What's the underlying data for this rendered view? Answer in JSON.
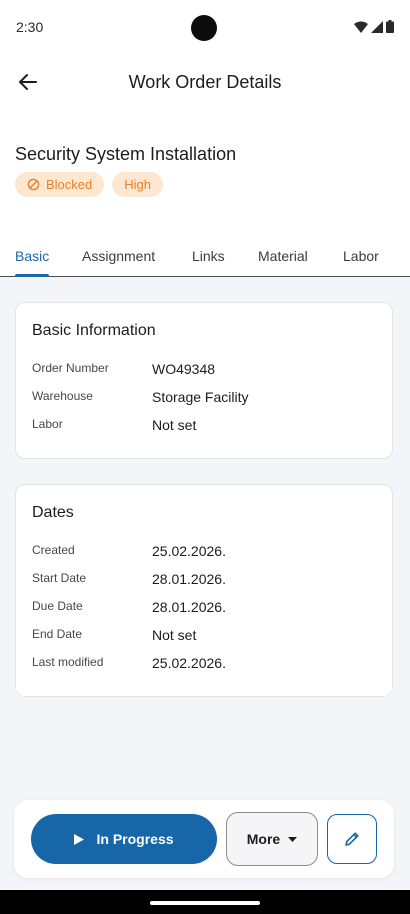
{
  "status_bar": {
    "time": "2:30"
  },
  "app_bar": {
    "title": "Work Order Details",
    "back_icon": "arrow-left-icon"
  },
  "work_order": {
    "title": "Security System Installation",
    "badges": [
      {
        "label": "Blocked",
        "icon": "blocked-icon",
        "color": "#e3832b",
        "bg": "#fde7d1"
      },
      {
        "label": "High",
        "color": "#e3832b",
        "bg": "#fde7d1"
      }
    ]
  },
  "tabs": [
    {
      "label": "Basic",
      "active": true
    },
    {
      "label": "Assignment"
    },
    {
      "label": "Links"
    },
    {
      "label": "Material"
    },
    {
      "label": "Labor"
    }
  ],
  "basic_info": {
    "title": "Basic Information",
    "rows": [
      {
        "label": "Order Number",
        "value": "WO49348"
      },
      {
        "label": "Warehouse",
        "value": "Storage Facility"
      },
      {
        "label": "Labor",
        "value": "Not set"
      }
    ]
  },
  "dates": {
    "title": "Dates",
    "rows": [
      {
        "label": "Created",
        "value": "25.02.2026."
      },
      {
        "label": "Start Date",
        "value": "28.01.2026."
      },
      {
        "label": "Due Date",
        "value": "28.01.2026."
      },
      {
        "label": "End Date",
        "value": "Not set"
      },
      {
        "label": "Last modified",
        "value": "25.02.2026."
      }
    ]
  },
  "actions": {
    "primary_label": "In Progress",
    "primary_icon": "play-icon",
    "more_label": "More",
    "more_icon": "caret-down-icon",
    "edit_icon": "pencil-icon"
  },
  "colors": {
    "accent": "#1766a7",
    "badge_text": "#e3832b",
    "badge_bg": "#fde7d1"
  }
}
